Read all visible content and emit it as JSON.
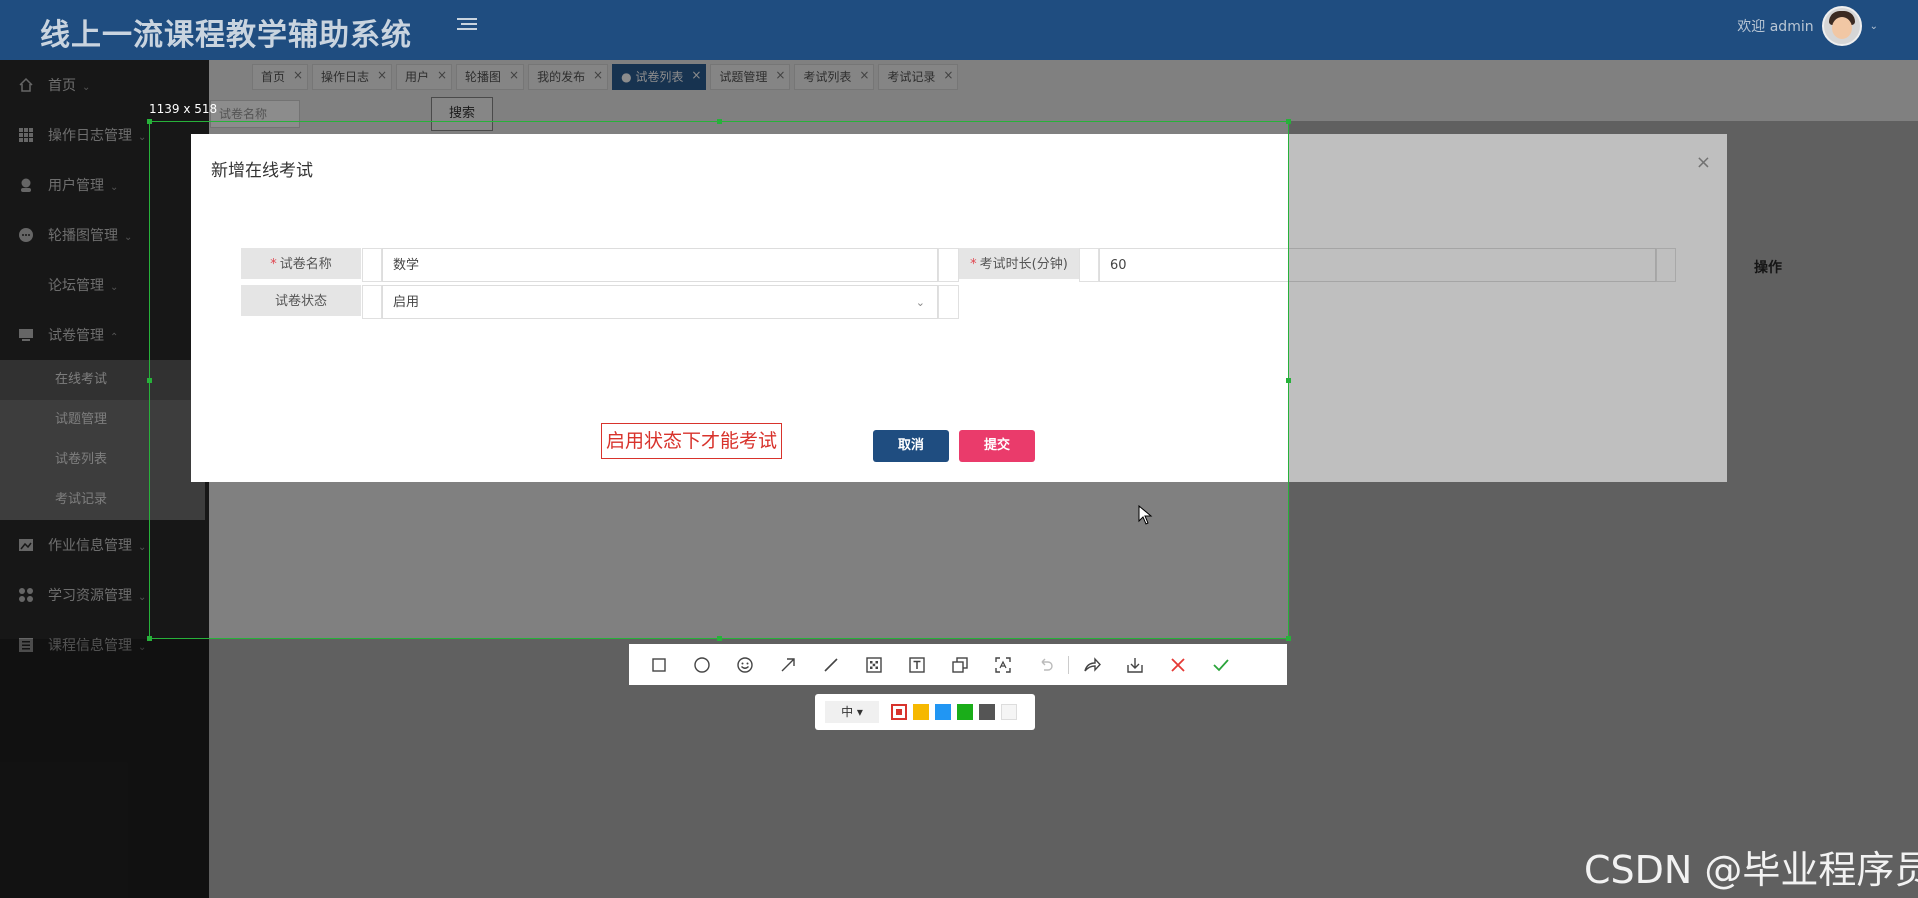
{
  "header": {
    "app_title": "线上一流课程教学辅助系统",
    "welcome": "欢迎 admin"
  },
  "sidebar": {
    "items": [
      {
        "label": "首页",
        "icon": "home-icon"
      },
      {
        "label": "操作日志管理",
        "icon": "grid-icon"
      },
      {
        "label": "用户管理",
        "icon": "user-icon"
      },
      {
        "label": "轮播图管理",
        "icon": "chat-icon"
      },
      {
        "label": "论坛管理",
        "icon": ""
      },
      {
        "label": "试卷管理",
        "icon": "monitor-icon"
      },
      {
        "label": "作业信息管理",
        "icon": "image-icon"
      },
      {
        "label": "学习资源管理",
        "icon": "apps-icon"
      },
      {
        "label": "课程信息管理",
        "icon": "list-icon"
      }
    ],
    "submenu": [
      "在线考试",
      "试题管理",
      "试卷列表",
      "考试记录"
    ]
  },
  "tabs": [
    {
      "label": "首页",
      "active": false
    },
    {
      "label": "操作日志",
      "active": false
    },
    {
      "label": "用户",
      "active": false
    },
    {
      "label": "轮播图",
      "active": false
    },
    {
      "label": "我的发布",
      "active": false
    },
    {
      "label": "● 试卷列表",
      "active": true
    },
    {
      "label": "试题管理",
      "active": false
    },
    {
      "label": "考试列表",
      "active": false
    },
    {
      "label": "考试记录",
      "active": false
    }
  ],
  "search": {
    "placeholder": "试卷名称",
    "button": "搜索"
  },
  "table": {
    "operation_header": "操作"
  },
  "modal": {
    "title": "新增在线考试",
    "close": "×",
    "fields": {
      "name_label": "试卷名称",
      "name_value": "数学",
      "duration_label": "考试时长(分钟)",
      "duration_value": "60",
      "status_label": "试卷状态",
      "status_value": "启用"
    },
    "required_mark": "*",
    "hint": "启用状态下才能考试",
    "cancel": "取消",
    "submit": "提交"
  },
  "capture": {
    "size_label": "1139 x 518",
    "pen_size": "中 ▾",
    "tools": [
      "rectangle-icon",
      "ellipse-icon",
      "emoji-icon",
      "arrow-icon",
      "line-icon",
      "mosaic-icon",
      "text-icon",
      "copy-icon",
      "ocr-icon",
      "undo-icon",
      "share-icon",
      "download-icon",
      "cancel-icon",
      "confirm-icon"
    ],
    "colors": [
      "#d8332c",
      "#f6b800",
      "#2196f3",
      "#1aad19",
      "#555555",
      "#f5f5f5"
    ]
  },
  "watermark": "CSDN @毕业程序员"
}
